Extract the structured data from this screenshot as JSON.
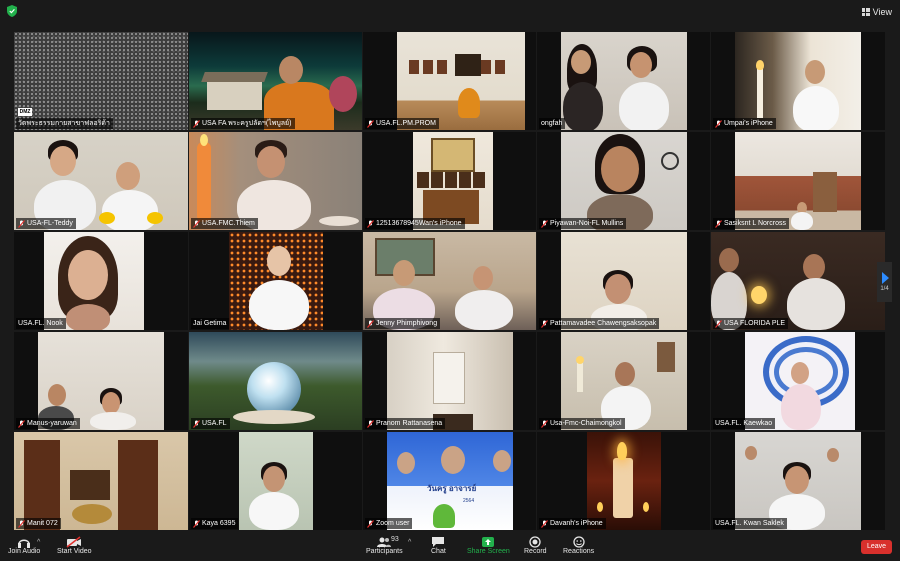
{
  "app": {
    "view_label": "View",
    "page_indicator": "1/4"
  },
  "participants_grid": [
    {
      "name": "วัดพระธรรมกายสาขาฟลอริด้า",
      "sub": "DMZ"
    },
    {
      "name": "USA FA พระครูปลัดฯ(ไพบูลย์)"
    },
    {
      "name": "USA.FL.PM.PROM"
    },
    {
      "name": "ongfah"
    },
    {
      "name": "Umpai's iPhone"
    },
    {
      "name": "USA-FL-Teddy"
    },
    {
      "name": "USA.FMC.Thiem"
    },
    {
      "name": "12513678945Wan's iPhone"
    },
    {
      "name": "Piyawan-Noi-FL Mullins"
    },
    {
      "name": "Sasiksnt L Norcross"
    },
    {
      "name": "USA.FL. Nook"
    },
    {
      "name": "Jai Getima"
    },
    {
      "name": "Jenny Phimphivong"
    },
    {
      "name": "Pattamavadee Chawengsaksopak"
    },
    {
      "name": "USA FLORIDA PLE"
    },
    {
      "name": "Manus-yaruwan"
    },
    {
      "name": "USA.FL"
    },
    {
      "name": "Pranom Rattanasena"
    },
    {
      "name": "Usa-Fmc-Chaimongkol"
    },
    {
      "name": "USA.FL. Kaewkao"
    },
    {
      "name": "Manit 072"
    },
    {
      "name": "Kaya 6395"
    },
    {
      "name": "Zoom user",
      "banner": "วันครู อาจารย์",
      "banner_sub": "2564"
    },
    {
      "name": "Davanh's iPhone"
    },
    {
      "name": "USA.FL. Kwan Saklek"
    }
  ],
  "toolbar": {
    "join_audio": "Join Audio",
    "start_video": "Start Video",
    "participants": "Participants",
    "participants_count": "93",
    "chat": "Chat",
    "share_screen": "Share Screen",
    "record": "Record",
    "reactions": "Reactions",
    "leave": "Leave"
  },
  "colors": {
    "accent_green": "#22b14c",
    "speaker_outline": "#d6e234",
    "leave_red": "#d8302c",
    "muted_red": "#e0322f"
  }
}
